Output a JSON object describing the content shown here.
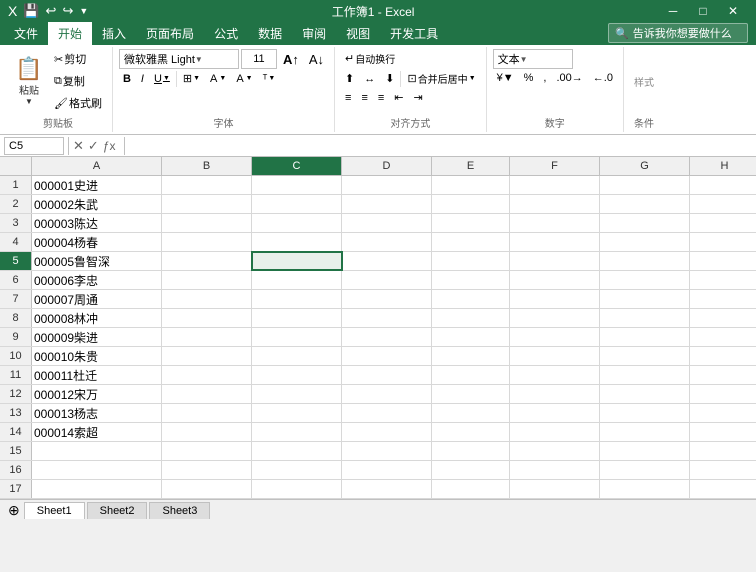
{
  "titleBar": {
    "filename": "工作簿1 - Excel",
    "quickAccess": [
      "save",
      "undo",
      "redo"
    ],
    "winControls": [
      "minimize",
      "restore",
      "close"
    ]
  },
  "ribbon": {
    "tabs": [
      "文件",
      "开始",
      "插入",
      "页面布局",
      "公式",
      "数据",
      "审阅",
      "视图",
      "开发工具"
    ],
    "activeTab": "开始",
    "groups": {
      "clipboard": {
        "label": "剪贴板",
        "buttons": [
          "粘贴",
          "剪切",
          "复制",
          "格式刷"
        ]
      },
      "font": {
        "label": "字体",
        "fontName": "微软雅黑 Light",
        "fontSize": "11",
        "buttons": [
          "B",
          "I",
          "U",
          "border",
          "fill",
          "fontColor",
          "wrapText"
        ]
      },
      "alignment": {
        "label": "对齐方式",
        "buttons": [
          "autoWrap",
          "mergeCenter",
          "alignLeft",
          "alignCenter",
          "alignRight"
        ]
      },
      "number": {
        "label": "数字",
        "format": "文本",
        "buttons": [
          "percent",
          "comma",
          "increaseDecimal",
          "decreaseDecimal"
        ]
      }
    },
    "askBox": "♀ 告诉我你想要做什么"
  },
  "formulaBar": {
    "cellRef": "C5",
    "formula": ""
  },
  "columns": [
    "A",
    "B",
    "C",
    "D",
    "E",
    "F",
    "G",
    "H"
  ],
  "rows": [
    {
      "num": 1,
      "a": "000001史进",
      "b": "",
      "c": "",
      "d": "",
      "e": "",
      "f": "",
      "g": "",
      "h": ""
    },
    {
      "num": 2,
      "a": "000002朱武",
      "b": "",
      "c": "",
      "d": "",
      "e": "",
      "f": "",
      "g": "",
      "h": ""
    },
    {
      "num": 3,
      "a": "000003陈达",
      "b": "",
      "c": "",
      "d": "",
      "e": "",
      "f": "",
      "g": "",
      "h": ""
    },
    {
      "num": 4,
      "a": "000004杨春",
      "b": "",
      "c": "",
      "d": "",
      "e": "",
      "f": "",
      "g": "",
      "h": ""
    },
    {
      "num": 5,
      "a": "000005鲁智深",
      "b": "",
      "c": "",
      "d": "",
      "e": "",
      "f": "",
      "g": "",
      "h": ""
    },
    {
      "num": 6,
      "a": "000006李忠",
      "b": "",
      "c": "",
      "d": "",
      "e": "",
      "f": "",
      "g": "",
      "h": ""
    },
    {
      "num": 7,
      "a": "000007周通",
      "b": "",
      "c": "",
      "d": "",
      "e": "",
      "f": "",
      "g": "",
      "h": ""
    },
    {
      "num": 8,
      "a": "000008林冲",
      "b": "",
      "c": "",
      "d": "",
      "e": "",
      "f": "",
      "g": "",
      "h": ""
    },
    {
      "num": 9,
      "a": "000009柴进",
      "b": "",
      "c": "",
      "d": "",
      "e": "",
      "f": "",
      "g": "",
      "h": ""
    },
    {
      "num": 10,
      "a": "000010朱贵",
      "b": "",
      "c": "",
      "d": "",
      "e": "",
      "f": "",
      "g": "",
      "h": ""
    },
    {
      "num": 11,
      "a": "000011杜迁",
      "b": "",
      "c": "",
      "d": "",
      "e": "",
      "f": "",
      "g": "",
      "h": ""
    },
    {
      "num": 12,
      "a": "000012宋万",
      "b": "",
      "c": "",
      "d": "",
      "e": "",
      "f": "",
      "g": "",
      "h": ""
    },
    {
      "num": 13,
      "a": "000013杨志",
      "b": "",
      "c": "",
      "d": "",
      "e": "",
      "f": "",
      "g": "",
      "h": ""
    },
    {
      "num": 14,
      "a": "000014索超",
      "b": "",
      "c": "",
      "d": "",
      "e": "",
      "f": "",
      "g": "",
      "h": ""
    },
    {
      "num": 15,
      "a": "",
      "b": "",
      "c": "",
      "d": "",
      "e": "",
      "f": "",
      "g": "",
      "h": ""
    },
    {
      "num": 16,
      "a": "",
      "b": "",
      "c": "",
      "d": "",
      "e": "",
      "f": "",
      "g": "",
      "h": ""
    },
    {
      "num": 17,
      "a": "",
      "b": "",
      "c": "",
      "d": "",
      "e": "",
      "f": "",
      "g": "",
      "h": ""
    }
  ],
  "sheetTabs": [
    "Sheet1",
    "Sheet2",
    "Sheet3"
  ],
  "activeSheet": "Sheet1",
  "colors": {
    "excelGreen": "#217346",
    "ribbonBg": "#fff",
    "headerBg": "#f0f0f0",
    "selectedCell": "#e8f0eb",
    "selectedBorder": "#217346"
  }
}
